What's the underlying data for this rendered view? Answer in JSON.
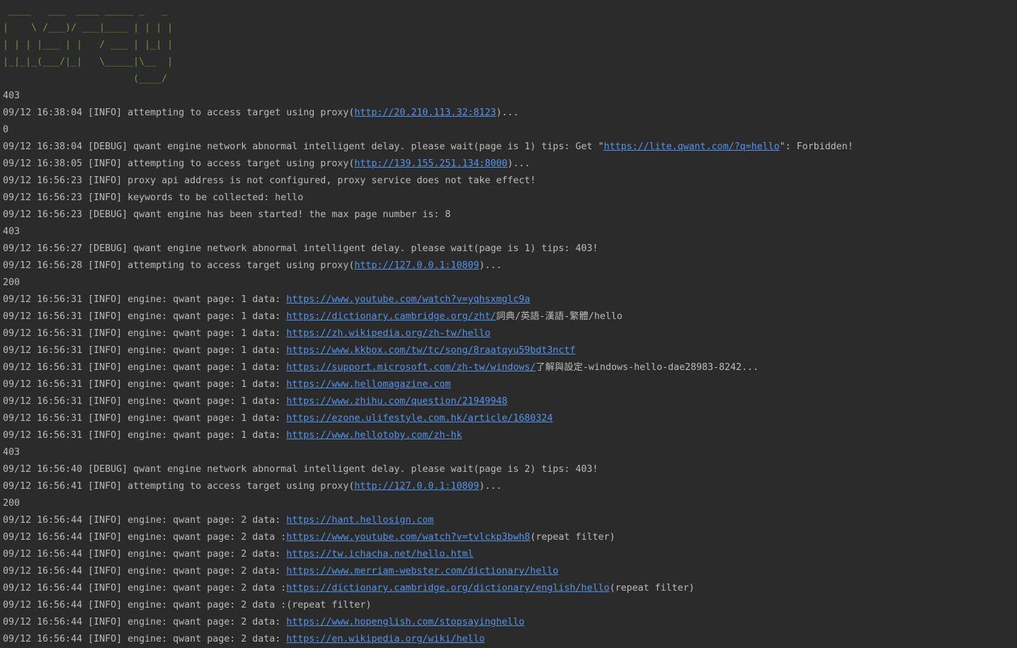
{
  "console": {
    "banner": [
      " ____   ___  ____ _____ _   _",
      "|    \\ /___)/ ___|____ | | | |",
      "| | | |___ | |   / ___ | |_| |",
      "|_|_|_(___/|_|   \\_____|\\__  |",
      "                       (____/"
    ],
    "lines": [
      {
        "text": "403"
      },
      {
        "pre": "09/12 16:38:04 [INFO] attempting to access target using proxy(",
        "link": "http://20.210.113.32:8123",
        "post": ")..."
      },
      {
        "text": "0"
      },
      {
        "pre": "09/12 16:38:04 [DEBUG] qwant engine network abnormal intelligent delay. please wait(page is 1) tips: Get \"",
        "link": "https://lite.qwant.com/?q=hello",
        "post": "\": Forbidden!"
      },
      {
        "pre": "09/12 16:38:05 [INFO] attempting to access target using proxy(",
        "link": "http://139.155.251.134:8000",
        "post": ")..."
      },
      {
        "text": "09/12 16:56:23 [INFO] proxy api address is not configured, proxy service does not take effect!"
      },
      {
        "text": "09/12 16:56:23 [INFO] keywords to be collected: hello"
      },
      {
        "text": "09/12 16:56:23 [DEBUG] qwant engine has been started! the max page number is: 8"
      },
      {
        "text": "403"
      },
      {
        "text": "09/12 16:56:27 [DEBUG] qwant engine network abnormal intelligent delay. please wait(page is 1) tips: 403!"
      },
      {
        "pre": "09/12 16:56:28 [INFO] attempting to access target using proxy(",
        "link": "http://127.0.0.1:10809",
        "post": ")..."
      },
      {
        "text": "200"
      },
      {
        "pre": "09/12 16:56:31 [INFO] engine: qwant page: 1 data: ",
        "link": "https://www.youtube.com/watch?v=yqhsxmglc9a",
        "post": ""
      },
      {
        "pre": "09/12 16:56:31 [INFO] engine: qwant page: 1 data: ",
        "link": "https://dictionary.cambridge.org/zht/",
        "post": "詞典/英語-漢語-繁體/hello"
      },
      {
        "pre": "09/12 16:56:31 [INFO] engine: qwant page: 1 data: ",
        "link": "https://zh.wikipedia.org/zh-tw/hello",
        "post": ""
      },
      {
        "pre": "09/12 16:56:31 [INFO] engine: qwant page: 1 data: ",
        "link": "https://www.kkbox.com/tw/tc/song/8raatqyu59bdt3nctf",
        "post": ""
      },
      {
        "pre": "09/12 16:56:31 [INFO] engine: qwant page: 1 data: ",
        "link": "https://support.microsoft.com/zh-tw/windows/",
        "post": "了解與設定-windows-hello-dae28983-8242..."
      },
      {
        "pre": "09/12 16:56:31 [INFO] engine: qwant page: 1 data: ",
        "link": "https://www.hellomagazine.com",
        "post": ""
      },
      {
        "pre": "09/12 16:56:31 [INFO] engine: qwant page: 1 data: ",
        "link": "https://www.zhihu.com/question/21949948",
        "post": ""
      },
      {
        "pre": "09/12 16:56:31 [INFO] engine: qwant page: 1 data: ",
        "link": "https://ezone.ulifestyle.com.hk/article/1680324",
        "post": ""
      },
      {
        "pre": "09/12 16:56:31 [INFO] engine: qwant page: 1 data: ",
        "link": "https://www.hellotoby.com/zh-hk",
        "post": ""
      },
      {
        "text": "403"
      },
      {
        "text": "09/12 16:56:40 [DEBUG] qwant engine network abnormal intelligent delay. please wait(page is 2) tips: 403!"
      },
      {
        "pre": "09/12 16:56:41 [INFO] attempting to access target using proxy(",
        "link": "http://127.0.0.1:10809",
        "post": ")..."
      },
      {
        "text": "200"
      },
      {
        "pre": "09/12 16:56:44 [INFO] engine: qwant page: 2 data: ",
        "link": "https://hant.hellosign.com",
        "post": ""
      },
      {
        "pre": "09/12 16:56:44 [INFO] engine: qwant page: 2 data :",
        "link": "https://www.youtube.com/watch?v=tvlckp3bwh8",
        "post": "(repeat filter)"
      },
      {
        "pre": "09/12 16:56:44 [INFO] engine: qwant page: 2 data: ",
        "link": "https://tw.ichacha.net/hello.html",
        "post": ""
      },
      {
        "pre": "09/12 16:56:44 [INFO] engine: qwant page: 2 data: ",
        "link": "https://www.merriam-webster.com/dictionary/hello",
        "post": ""
      },
      {
        "pre": "09/12 16:56:44 [INFO] engine: qwant page: 2 data :",
        "link": "https://dictionary.cambridge.org/dictionary/english/hello",
        "post": "(repeat filter)"
      },
      {
        "text": "09/12 16:56:44 [INFO] engine: qwant page: 2 data :(repeat filter)"
      },
      {
        "pre": "09/12 16:56:44 [INFO] engine: qwant page: 2 data: ",
        "link": "https://www.hopenglish.com/stopsayinghello",
        "post": ""
      },
      {
        "pre": "09/12 16:56:44 [INFO] engine: qwant page: 2 data: ",
        "link": "https://en.wikipedia.org/wiki/hello",
        "post": ""
      }
    ]
  }
}
